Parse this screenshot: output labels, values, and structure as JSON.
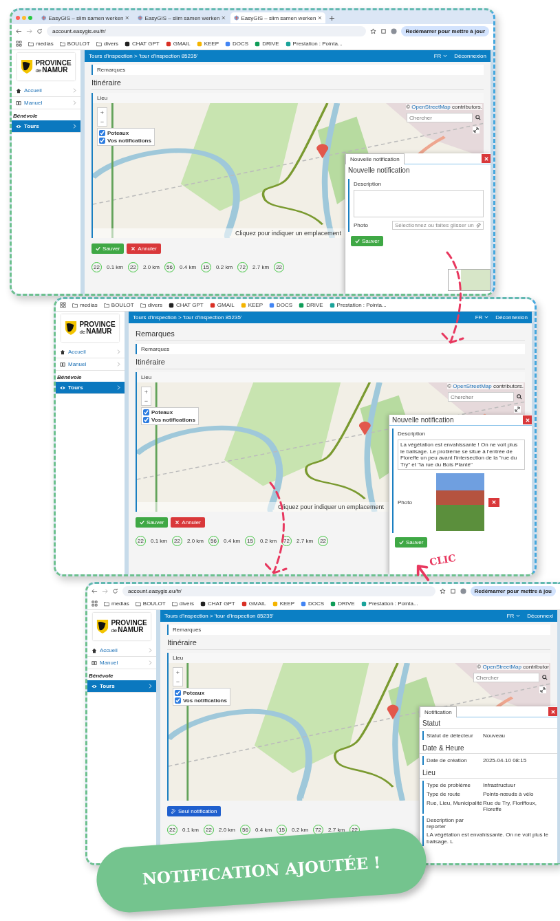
{
  "screens": [
    {
      "tabs": [
        {
          "label": "EasyGIS – slim samen werken",
          "selected": false
        },
        {
          "label": "EasyGIS – slim samen werken",
          "selected": false
        },
        {
          "label": "EasyGIS – slim samen werken",
          "selected": true
        }
      ],
      "url": "account.easygis.eu/fr/",
      "restart": "Redémarrer pour mettre à jour",
      "bookmarks": [
        {
          "label": "medias",
          "kind": "folder"
        },
        {
          "label": "BOULOT",
          "kind": "folder"
        },
        {
          "label": "divers",
          "kind": "folder"
        },
        {
          "label": "CHAT GPT",
          "kind": "site",
          "color": "#222222"
        },
        {
          "label": "GMAIL",
          "kind": "site",
          "color": "#d93025"
        },
        {
          "label": "KEEP",
          "kind": "site",
          "color": "#f4b400"
        },
        {
          "label": "DOCS",
          "kind": "site",
          "color": "#4285f4"
        },
        {
          "label": "DRIVE",
          "kind": "site",
          "color": "#0f9d58"
        },
        {
          "label": "Prestation : Pointa...",
          "kind": "site",
          "color": "#1aa39a"
        }
      ],
      "logo": {
        "line1": "PROVINCE",
        "small": "de",
        "line2": "NAMUR"
      },
      "nav": [
        {
          "kind": "link",
          "label": "Accueil",
          "selected": false
        },
        {
          "kind": "link",
          "label": "Manuel",
          "selected": false
        },
        {
          "kind": "section",
          "label": "Bénévole"
        },
        {
          "kind": "link",
          "label": "Tours",
          "selected": true
        }
      ],
      "breadcrumb": "Tours d'inspection > 'tour d'inspection 85235'",
      "lang": "FR",
      "logout": "Déconnexion",
      "remarks": "Remarques",
      "itinerary": "Itinéraire",
      "place": "Lieu",
      "map": {
        "attribution_prefix": "©",
        "attribution_link": "OpenStreetMap",
        "attribution_rest": "contributors.",
        "search_placeholder": "Chercher",
        "zoom_in": "+",
        "zoom_out": "−",
        "layers": [
          {
            "label": "Poteaux",
            "checked": true
          },
          {
            "label": "Vos notifications",
            "checked": true
          }
        ],
        "hint": "Cliquez pour indiquer un emplacement"
      },
      "buttons": [
        {
          "label": "Sauver",
          "kind": "save"
        },
        {
          "label": "Annuler",
          "kind": "cancel"
        }
      ],
      "segments": [
        {
          "kind": "node",
          "text": "22"
        },
        {
          "kind": "distance",
          "text": "0.1 km"
        },
        {
          "kind": "node",
          "text": "22"
        },
        {
          "kind": "distance",
          "text": "2.0 km"
        },
        {
          "kind": "node",
          "text": "56"
        },
        {
          "kind": "distance",
          "text": "0.4 km"
        },
        {
          "kind": "node",
          "text": "15"
        },
        {
          "kind": "distance",
          "text": "0.2 km"
        },
        {
          "kind": "node",
          "text": "72"
        },
        {
          "kind": "distance",
          "text": "2.7 km"
        },
        {
          "kind": "node",
          "text": "22"
        }
      ],
      "dialog": {
        "kind": "form",
        "tab": "Nouvelle notification",
        "title": "Nouvelle notification",
        "description_label": "Description",
        "photo_label": "Photo",
        "photo_attached": false,
        "photo_placeholder": "Sélectionnez ou faites glisser un",
        "save": "Sauver"
      }
    },
    {
      "bookmarks": [
        {
          "label": "medias",
          "kind": "folder"
        },
        {
          "label": "BOULOT",
          "kind": "folder"
        },
        {
          "label": "divers",
          "kind": "folder"
        },
        {
          "label": "CHAT GPT",
          "kind": "site",
          "color": "#222222"
        },
        {
          "label": "GMAIL",
          "kind": "site",
          "color": "#d93025"
        },
        {
          "label": "KEEP",
          "kind": "site",
          "color": "#f4b400"
        },
        {
          "label": "DOCS",
          "kind": "site",
          "color": "#4285f4"
        },
        {
          "label": "DRIVE",
          "kind": "site",
          "color": "#0f9d58"
        },
        {
          "label": "Prestation : Pointa...",
          "kind": "site",
          "color": "#1aa39a"
        }
      ],
      "logo": {
        "line1": "PROVINCE",
        "small": "de",
        "line2": "NAMUR"
      },
      "nav": [
        {
          "kind": "link",
          "label": "Accueil",
          "selected": false
        },
        {
          "kind": "link",
          "label": "Manuel",
          "selected": false
        },
        {
          "kind": "section",
          "label": "Bénévole"
        },
        {
          "kind": "link",
          "label": "Tours",
          "selected": true
        }
      ],
      "breadcrumb": "Tours d'inspection > 'tour d'inspection 85235'",
      "lang": "FR",
      "logout": "Déconnexion",
      "heading": "Remarques",
      "remarks": "Remarques",
      "itinerary": "Itinéraire",
      "place": "Lieu",
      "map": {
        "attribution_prefix": "©",
        "attribution_link": "OpenStreetMap",
        "attribution_rest": "contributors.",
        "search_placeholder": "Chercher",
        "zoom_in": "+",
        "zoom_out": "−",
        "layers": [
          {
            "label": "Poteaux",
            "checked": true
          },
          {
            "label": "Vos notifications",
            "checked": true
          }
        ],
        "hint": "Cliquez pour indiquer un emplacement"
      },
      "buttons": [
        {
          "label": "Sauver",
          "kind": "save"
        },
        {
          "label": "Annuler",
          "kind": "cancel"
        }
      ],
      "segments": [
        {
          "kind": "node",
          "text": "22"
        },
        {
          "kind": "distance",
          "text": "0.1 km"
        },
        {
          "kind": "node",
          "text": "22"
        },
        {
          "kind": "distance",
          "text": "2.0 km"
        },
        {
          "kind": "node",
          "text": "56"
        },
        {
          "kind": "distance",
          "text": "0.4 km"
        },
        {
          "kind": "node",
          "text": "15"
        },
        {
          "kind": "distance",
          "text": "0.2 km"
        },
        {
          "kind": "node",
          "text": "72"
        },
        {
          "kind": "distance",
          "text": "2.7 km"
        },
        {
          "kind": "node",
          "text": "22"
        }
      ],
      "dialog": {
        "kind": "form",
        "title": "Nouvelle notification",
        "description_label": "Description",
        "description": "La végétation est envahissante ! On ne voit plus le balisage. Le problème se situe à l'entrée de Floreffe un peu avant l'intersection de la \"rue du Try\" et \"la rue du Bois Planté\"",
        "photo_label": "Photo",
        "photo_attached": true,
        "save": "Sauver"
      }
    },
    {
      "url": "account.easygis.eu/fr/",
      "restart": "Redémarrer pour mettre à jou",
      "bookmarks": [
        {
          "label": "medias",
          "kind": "folder"
        },
        {
          "label": "BOULOT",
          "kind": "folder"
        },
        {
          "label": "divers",
          "kind": "folder"
        },
        {
          "label": "CHAT GPT",
          "kind": "site",
          "color": "#222222"
        },
        {
          "label": "GMAIL",
          "kind": "site",
          "color": "#d93025"
        },
        {
          "label": "KEEP",
          "kind": "site",
          "color": "#f4b400"
        },
        {
          "label": "DOCS",
          "kind": "site",
          "color": "#4285f4"
        },
        {
          "label": "DRIVE",
          "kind": "site",
          "color": "#0f9d58"
        },
        {
          "label": "Prestation : Pointa...",
          "kind": "site",
          "color": "#1aa39a"
        }
      ],
      "logo": {
        "line1": "PROVINCE",
        "small": "de",
        "line2": "NAMUR"
      },
      "nav": [
        {
          "kind": "link",
          "label": "Accueil",
          "selected": false
        },
        {
          "kind": "link",
          "label": "Manuel",
          "selected": false
        },
        {
          "kind": "section",
          "label": "Bénévole"
        },
        {
          "kind": "link",
          "label": "Tours",
          "selected": true
        }
      ],
      "breadcrumb": "Tours d'inspection > 'tour d'inspection 85235'",
      "lang": "FR",
      "logout": "Déconnexi",
      "remarks": "Remarques",
      "itinerary": "Itinéraire",
      "place": "Lieu",
      "map": {
        "attribution_prefix": "©",
        "attribution_link": "OpenStreetMap",
        "attribution_rest": "contributor",
        "search_placeholder": "Chercher",
        "zoom_in": "+",
        "zoom_out": "−",
        "layers": [
          {
            "label": "Poteaux",
            "checked": true
          },
          {
            "label": "Vos notifications",
            "checked": true
          }
        ]
      },
      "buttons": [
        {
          "label": "Seul notification",
          "kind": "edit"
        }
      ],
      "segments": [
        {
          "kind": "node",
          "text": "22"
        },
        {
          "kind": "distance",
          "text": "0.1 km"
        },
        {
          "kind": "node",
          "text": "22"
        },
        {
          "kind": "distance",
          "text": "2.0 km"
        },
        {
          "kind": "node",
          "text": "56"
        },
        {
          "kind": "distance",
          "text": "0.4 km"
        },
        {
          "kind": "node",
          "text": "15"
        },
        {
          "kind": "distance",
          "text": "0.2 km"
        },
        {
          "kind": "node",
          "text": "72"
        },
        {
          "kind": "distance",
          "text": "2.7 km"
        },
        {
          "kind": "node",
          "text": "22"
        }
      ],
      "dialog": {
        "kind": "details",
        "tab": "Notification",
        "sections": [
          {
            "title": "Statut",
            "rows": [
              {
                "label": "Statut de détecteur",
                "value": "Nouveau"
              }
            ]
          },
          {
            "title": "Date & Heure",
            "rows": [
              {
                "label": "Date de création",
                "value": "2025-04-10 08:15"
              }
            ]
          },
          {
            "title": "Lieu",
            "rows": [
              {
                "label": "Type de problème",
                "value": "Infrastructuur"
              },
              {
                "label": "Type de route",
                "value": "Points-nœuds à vélo"
              },
              {
                "label": "Rue, Lieu, Municipalité",
                "value": "Rue du Try, Floriffoux, Floreffe"
              }
            ]
          }
        ],
        "description_label": "Description par reporter",
        "description": "LA végétation est envahissante. On ne voit plus le balisage. L"
      }
    }
  ],
  "clic_label": "CLIC",
  "banner": "NOTIFICATION AJOUTÉE !"
}
